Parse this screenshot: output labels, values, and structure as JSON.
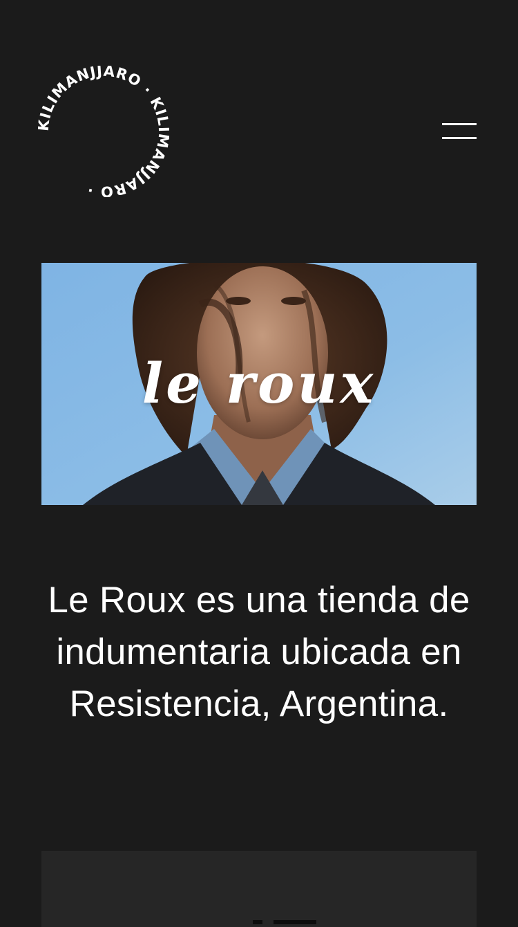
{
  "header": {
    "logo_text": "KILIMANJJARO · KILIMANJJARO · ",
    "menu_icon": "hamburger-icon"
  },
  "hero": {
    "title": "le roux"
  },
  "intro": {
    "text": "Le Roux es una tienda de indumentaria ubicada en Resistencia, Argentina."
  },
  "colors": {
    "background": "#1b1b1b",
    "text": "#ffffff",
    "card": "#262626"
  }
}
